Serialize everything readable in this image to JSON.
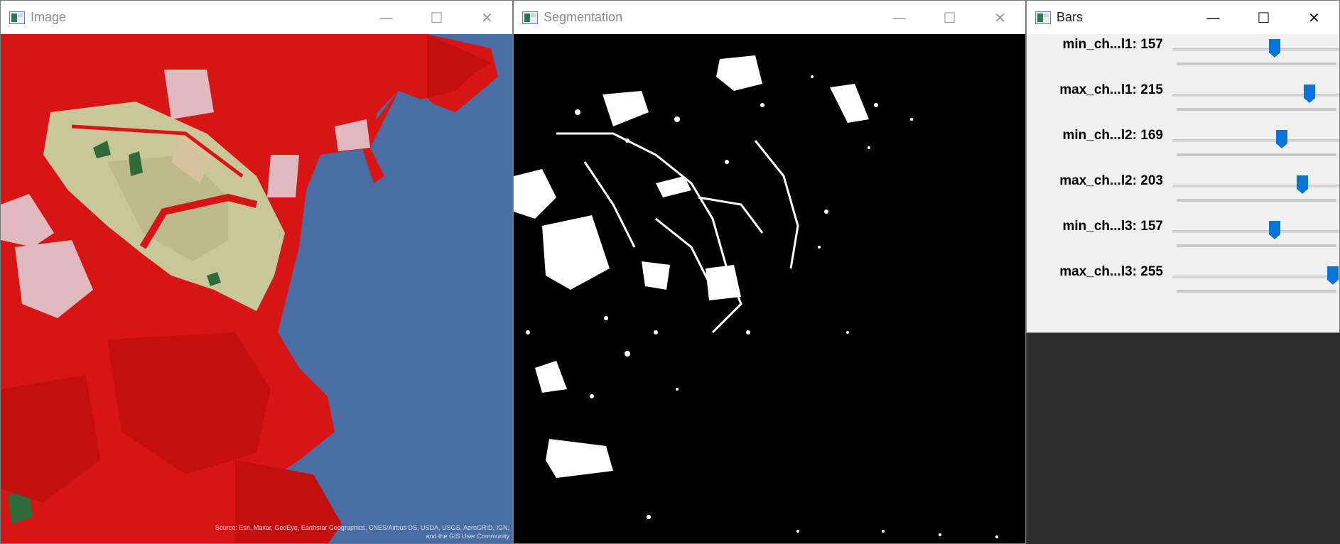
{
  "windows": {
    "image": {
      "title": "Image",
      "attribution": "Source: Esri, Maxar, GeoEye, Earthstar Geographics, CNES/Airbus DS, USDA, USGS, AeroGRID, IGN, and the GIS User Community"
    },
    "segmentation": {
      "title": "Segmentation"
    },
    "bars": {
      "title": "Bars"
    }
  },
  "controls": {
    "minimize": "—",
    "maximize": "☐",
    "close": "✕"
  },
  "trackbars": [
    {
      "label": "min_ch...l1: 157",
      "value": 157,
      "max": 255
    },
    {
      "label": "max_ch...l1: 215",
      "value": 215,
      "max": 255
    },
    {
      "label": "min_ch...l2: 169",
      "value": 169,
      "max": 255
    },
    {
      "label": "max_ch...l2: 203",
      "value": 203,
      "max": 255
    },
    {
      "label": "min_ch...l3: 157",
      "value": 157,
      "max": 255
    },
    {
      "label": "max_ch...l3: 255",
      "value": 255,
      "max": 255
    }
  ],
  "colors": {
    "water": "#4a6da3",
    "urban": "#d81515",
    "park": "#c9c79a",
    "forest": "#2f6b3a",
    "accent_thumb": "#0a74d6"
  },
  "icons": [
    "app-icon",
    "minimize-icon",
    "maximize-icon",
    "close-icon"
  ]
}
